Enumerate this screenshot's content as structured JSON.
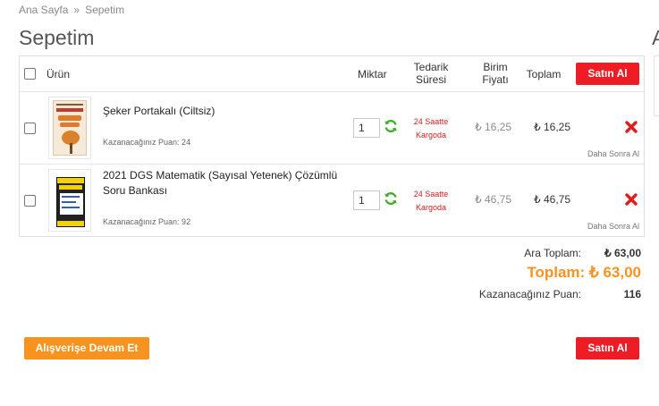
{
  "breadcrumb": {
    "home": "Ana Sayfa",
    "separator": "»",
    "current": "Sepetim"
  },
  "page_title": "Sepetim",
  "edge_letter": "A",
  "table": {
    "headers": {
      "product": "Ürün",
      "quantity": "Miktar",
      "supply_line1": "Tedarik",
      "supply_line2": "Süresi",
      "unit_line1": "Birim",
      "unit_line2": "Fiyatı",
      "total": "Toplam"
    },
    "buy_label": "Satın Al"
  },
  "items": [
    {
      "name": "Şeker Portakalı (Ciltsiz)",
      "points": "Kazanacağınız Puan: 24",
      "quantity": "1",
      "delivery_line1": "24 Saatte",
      "delivery_line2": "Kargoda",
      "unit_price": "₺ 16,25",
      "total_price": "₺ 16,25",
      "later": "Daha Sonra Al"
    },
    {
      "name": "2021 DGS Matematik (Sayısal Yetenek) Çözümlü Soru Bankası",
      "points": "Kazanacağınız Puan: 92",
      "quantity": "1",
      "delivery_line1": "24 Saatte",
      "delivery_line2": "Kargoda",
      "unit_price": "₺ 46,75",
      "total_price": "₺ 46,75",
      "later": "Daha Sonra Al"
    }
  ],
  "summary": {
    "subtotal_label": "Ara Toplam:",
    "subtotal_value": "₺ 63,00",
    "total_text": "Toplam: ₺ 63,00",
    "points_label": "Kazanacağınız Puan:",
    "points_value": "116"
  },
  "actions": {
    "continue_label": "Alışverişe Devam Et",
    "buy_label": "Satın Al"
  },
  "colors": {
    "accent": "#ee1c25",
    "orange": "#f7931e",
    "refresh": "#3fae29",
    "delivery": "#d01f1f"
  },
  "icons": {
    "refresh": "refresh-icon",
    "remove": "remove-icon"
  }
}
